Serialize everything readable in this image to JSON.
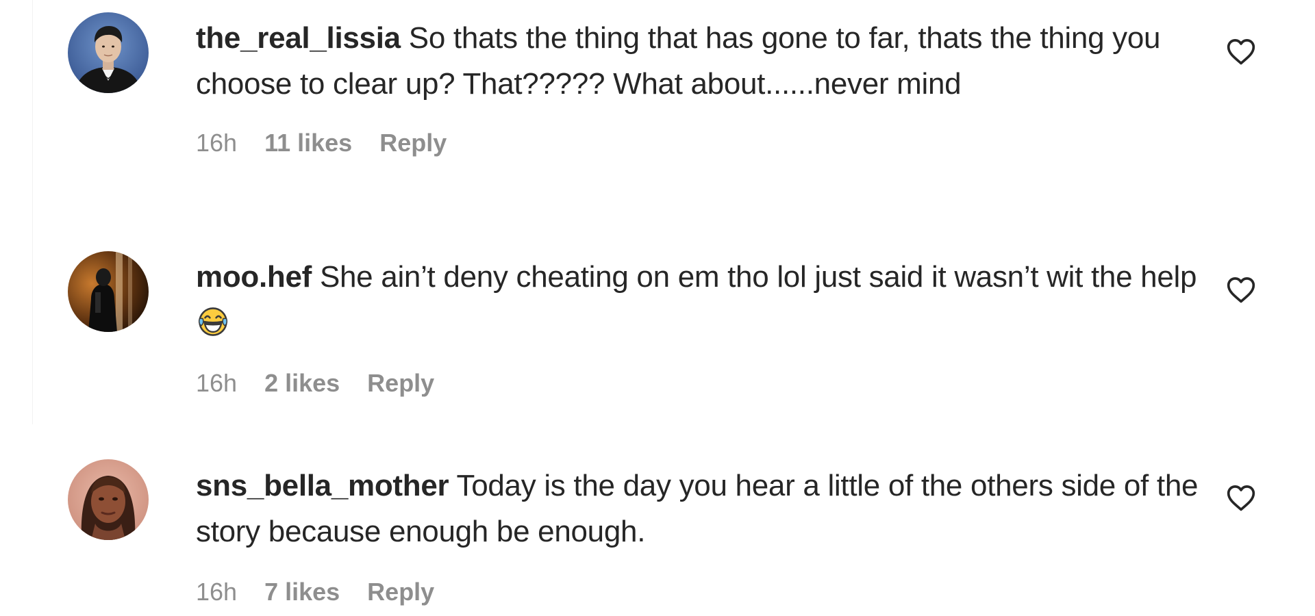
{
  "comments": [
    {
      "username": "the_real_lissia",
      "text": "So thats the thing that has gone to far, thats the thing you choose to clear up? That????? What about......never mind",
      "emoji": "",
      "time": "16h",
      "likes": "11 likes",
      "reply": "Reply",
      "avatar_icon": "avatar-photo",
      "like_icon": "heart-outline-icon"
    },
    {
      "username": "moo.hef",
      "text": "She ain’t deny cheating on em tho lol just said it wasn’t wit the help",
      "emoji": "😂",
      "time": "16h",
      "likes": "2 likes",
      "reply": "Reply",
      "avatar_icon": "avatar-photo",
      "like_icon": "heart-outline-icon"
    },
    {
      "username": "sns_bella_mother",
      "text": "Today is the day you hear a little of the others side of the story because enough be enough.",
      "emoji": "",
      "time": "16h",
      "likes": "7 likes",
      "reply": "Reply",
      "avatar_icon": "avatar-photo",
      "like_icon": "heart-outline-icon"
    }
  ],
  "colors": {
    "text": "#262626",
    "muted": "#8e8e8e",
    "background": "#ffffff"
  }
}
